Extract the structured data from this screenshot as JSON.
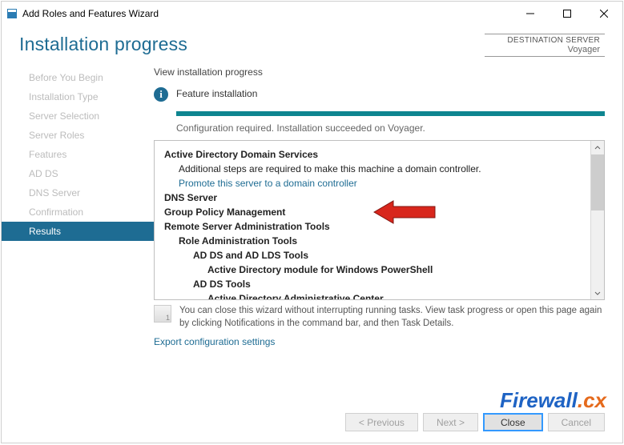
{
  "window": {
    "title": "Add Roles and Features Wizard"
  },
  "header": {
    "page_title": "Installation progress",
    "destination_label": "DESTINATION SERVER",
    "destination_name": "Voyager"
  },
  "sidebar": {
    "items": [
      {
        "label": "Before You Begin"
      },
      {
        "label": "Installation Type"
      },
      {
        "label": "Server Selection"
      },
      {
        "label": "Server Roles"
      },
      {
        "label": "Features"
      },
      {
        "label": "AD DS"
      },
      {
        "label": "DNS Server"
      },
      {
        "label": "Confirmation"
      },
      {
        "label": "Results"
      }
    ],
    "active_index": 8
  },
  "content": {
    "heading": "View installation progress",
    "status_label": "Feature installation",
    "status_subtext": "Configuration required. Installation succeeded on Voyager.",
    "details": {
      "adds_title": "Active Directory Domain Services",
      "adds_note": "Additional steps are required to make this machine a domain controller.",
      "promote_link": "Promote this server to a domain controller",
      "dns_title": "DNS Server",
      "gpm_title": "Group Policy Management",
      "rsat_title": "Remote Server Administration Tools",
      "role_admin": "Role Administration Tools",
      "adds_lds": "AD DS and AD LDS Tools",
      "ad_ps": "Active Directory module for Windows PowerShell",
      "adds_tools": "AD DS Tools",
      "adac": "Active Directory Administrative Center"
    },
    "hint_text": "You can close this wizard without interrupting running tasks. View task progress or open this page again by clicking Notifications in the command bar, and then Task Details.",
    "export_link": "Export configuration settings"
  },
  "footer": {
    "previous": "< Previous",
    "next": "Next >",
    "close": "Close",
    "cancel": "Cancel"
  },
  "watermark": {
    "a": "Firewall",
    "b": ".cx"
  }
}
